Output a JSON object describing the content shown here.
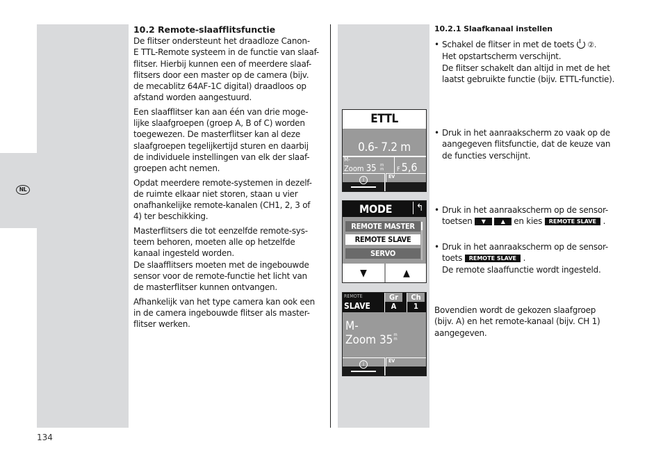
{
  "language_tab": "NL",
  "page_number": "134",
  "left_column": {
    "heading": "10.2 Remote-slaafflitsfunctie",
    "paragraphs": [
      [
        "De flitser ondersteunt het draadloze Canon-",
        "E TTL-Remote systeem in de functie van slaaf-",
        "flitser. Hierbij kunnen een of meerdere slaaf-",
        "flitsers door een master op de camera (bijv.",
        "de mecablitz 64AF-1C digital) draadloos op",
        "afstand worden aangestuurd."
      ],
      [
        "Een slaafflitser kan aan één van drie moge-",
        "lijke slaafgroepen (groep A, B of C) worden",
        "toegewezen. De masterflitser kan al deze",
        "slaafgroepen tegelijkertijd sturen en daarbij",
        "de individuele instellingen van elk der slaaf-",
        "groepen acht nemen."
      ],
      [
        "Opdat meerdere remote-systemen in dezelf-",
        "de ruimte elkaar niet storen, staan u vier",
        "onafhankelijke remote-kanalen (CH1, 2, 3 of",
        "4) ter beschikking."
      ],
      [
        "Masterflitsers die tot eenzelfde remote-sys-",
        "teem behoren, moeten alle op hetzelfde",
        "kanaal ingesteld worden.",
        "De slaafflitsers moeten met de ingebouwde",
        "sensor voor de remote-functie het licht van",
        "de masterflitser kunnen ontvangen."
      ],
      [
        "Afhankelijk van het type camera kan ook een",
        "in de camera ingebouwde flitser als master-",
        "flitser werken."
      ]
    ]
  },
  "right_column": {
    "heading": "10.2.1 Slaafkanaal instellen",
    "step1": {
      "line1_prefix": "Schakel de flitser in met de toets",
      "line1_ref": "②.",
      "lines": [
        "Het opstartscherm verschijnt.",
        "De flitser schakelt dan altijd in met de het",
        "laatst gebruikte functie (bijv. ETTL-functie)."
      ]
    },
    "step2": [
      "Druk in het aanraakscherm zo vaak op de",
      "aangegeven flitsfunctie, dat de keuze van",
      "de functies verschijnt."
    ],
    "step3": {
      "line1": "Druk in het aanraakscherm op de sensor-",
      "line2_prefix": "toetsen",
      "line2_mid": "en kies",
      "key_label": "REMOTE SLAVE",
      "line2_suffix": "."
    },
    "step4": {
      "line1": "Druk in het aanraakscherm op de sensor-",
      "line2_prefix": "toets",
      "key_label": "REMOTE SLAVE",
      "line2_suffix": ".",
      "line3": "De remote slaaffunctie wordt ingesteld."
    },
    "closing": [
      "Bovendien wordt de gekozen slaafgroep",
      "(bijv. A) en het remote-kanaal (bijv. CH 1)",
      "aangegeven."
    ],
    "bullet": "•"
  },
  "screens": {
    "ettl": {
      "title": "ETTL",
      "range": "0.6- 7.2 m",
      "mode_small": "M-",
      "zoom_label": "Zoom",
      "zoom_value": "35",
      "zoom_unit": "m m",
      "f_label": "F",
      "f_value": "5,6",
      "info_glyph": "i",
      "ev_label": "EV"
    },
    "mode": {
      "title": "MODE",
      "back_glyph": "↰",
      "items": [
        "REMOTE MASTER",
        "REMOTE SLAVE",
        "SERVO"
      ],
      "selected": "REMOTE SLAVE",
      "down_glyph": "▼",
      "up_glyph": "▲"
    },
    "slave": {
      "remote_label": "REMOTE",
      "slave_label": "SLAVE",
      "gr_label": "Gr",
      "gr_value": "A",
      "ch_label": "Ch",
      "ch_value": "1",
      "mode_line": "M-",
      "zoom_line": "Zoom 35",
      "zoom_unit": "m m",
      "info_glyph": "i",
      "ev_label": "EV"
    }
  }
}
